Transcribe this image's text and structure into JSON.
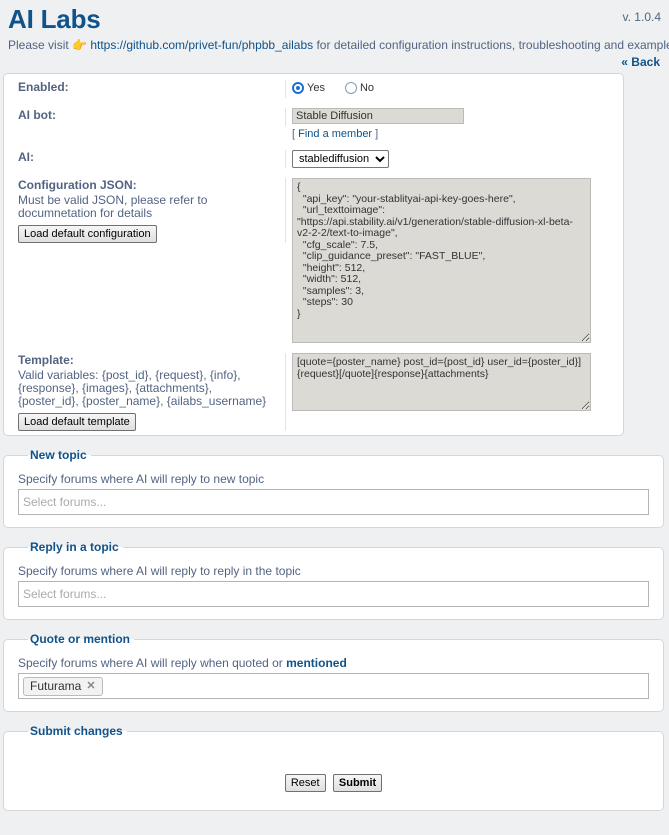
{
  "header": {
    "title": "AI Labs",
    "version": "v. 1.0.4",
    "intro_prefix": "Please visit ",
    "intro_emoji": "👉",
    "intro_link": "https://github.com/privet-fun/phpbb_ailabs",
    "intro_suffix": " for detailed configuration instructions, troubleshooting and examples.",
    "back_label": "« Back"
  },
  "form": {
    "enabled": {
      "label": "Enabled:",
      "options": [
        {
          "label": "Yes",
          "checked": true
        },
        {
          "label": "No",
          "checked": false
        }
      ]
    },
    "ai_bot": {
      "label": "AI bot:",
      "value": "Stable Diffusion",
      "find_member_open": "[ ",
      "find_member_link": "Find a member",
      "find_member_close": " ]"
    },
    "ai": {
      "label": "AI:",
      "selected": "stablediffusion",
      "options": [
        "stablediffusion"
      ]
    },
    "config_json": {
      "label": "Configuration JSON:",
      "description": "Must be valid JSON, please refer to documnetation for details",
      "button_label": "Load default configuration",
      "value": "{\n  \"api_key\": \"your-stablityai-api-key-goes-here\",\n  \"url_texttoimage\": \"https://api.stability.ai/v1/generation/stable-diffusion-xl-beta-v2-2-2/text-to-image\",\n  \"cfg_scale\": 7.5,\n  \"clip_guidance_preset\": \"FAST_BLUE\",\n  \"height\": 512,\n  \"width\": 512,\n  \"samples\": 3,\n  \"steps\": 30\n}"
    },
    "template": {
      "label": "Template:",
      "description": "Valid variables: {post_id}, {request}, {info}, {response}, {images}, {attachments}, {poster_id}, {poster_name}, {ailabs_username}",
      "button_label": "Load default template",
      "value": "[quote={poster_name} post_id={post_id} user_id={poster_id}]{request}[/quote]{response}{attachments}"
    }
  },
  "sections": {
    "new_topic": {
      "legend": "New topic",
      "description": "Specify forums where AI will reply to new topic",
      "placeholder": "Select forums...",
      "tags": []
    },
    "reply_topic": {
      "legend": "Reply in a topic",
      "description": "Specify forums where AI will reply to reply in the topic",
      "placeholder": "Select forums...",
      "tags": []
    },
    "quote_mention": {
      "legend": "Quote or mention",
      "description_prefix": "Specify forums where AI will reply when quoted or ",
      "description_link": "mentioned",
      "placeholder": "",
      "tags": [
        "Futurama"
      ],
      "tag_remove_icon": "✕"
    },
    "submit": {
      "legend": "Submit changes",
      "reset_label": "Reset",
      "submit_label": "Submit"
    }
  },
  "colors": {
    "accent": "#105289",
    "text": "#536482",
    "page_bg": "#eef0f2",
    "input_bg": "#dcdad5"
  }
}
